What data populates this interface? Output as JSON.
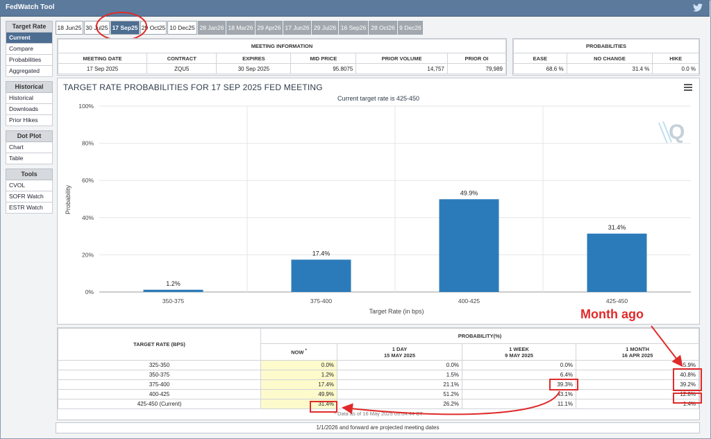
{
  "app": {
    "title": "FedWatch Tool"
  },
  "sidebar": {
    "groups": [
      {
        "heading": "Target Rate",
        "items": [
          "Current",
          "Compare",
          "Probabilities",
          "Aggregated"
        ]
      },
      {
        "heading": "Historical",
        "items": [
          "Historical",
          "Downloads",
          "Prior Hikes"
        ]
      },
      {
        "heading": "Dot Plot",
        "items": [
          "Chart",
          "Table"
        ]
      },
      {
        "heading": "Tools",
        "items": [
          "CVOL",
          "SOFR Watch",
          "ESTR Watch"
        ]
      }
    ],
    "active": "Current"
  },
  "tabs": [
    "18 Jun25",
    "30 Jul25",
    "17 Sep25",
    "29 Oct25",
    "10 Dec25",
    "28 Jan26",
    "18 Mar26",
    "29 Apr26",
    "17 Jun26",
    "29 Jul26",
    "16 Sep26",
    "28 Oct26",
    "9 Dec26"
  ],
  "meeting_info": {
    "heading": "MEETING INFORMATION",
    "columns": [
      "MEETING DATE",
      "CONTRACT",
      "EXPIRES",
      "MID PRICE",
      "PRIOR VOLUME",
      "PRIOR OI"
    ],
    "values": [
      "17 Sep 2025",
      "ZQU5",
      "30 Sep 2025",
      "95.8075",
      "14,757",
      "79,989"
    ]
  },
  "probabilities": {
    "heading": "PROBABILITIES",
    "columns": [
      "EASE",
      "NO CHANGE",
      "HIKE"
    ],
    "values": [
      "68.6 %",
      "31.4 %",
      "0.0 %"
    ]
  },
  "chart_data": {
    "type": "bar",
    "title": "TARGET RATE PROBABILITIES FOR 17 SEP 2025 FED MEETING",
    "subtitle": "Current target rate is 425-450",
    "xlabel": "Target Rate (in bps)",
    "ylabel": "Probability",
    "categories": [
      "350-375",
      "375-400",
      "400-425",
      "425-450"
    ],
    "values": [
      1.2,
      17.4,
      49.9,
      31.4
    ],
    "value_labels": [
      "1.2%",
      "17.4%",
      "49.9%",
      "31.4%"
    ],
    "ylim": [
      0,
      100
    ],
    "yticks": [
      "0%",
      "20%",
      "40%",
      "60%",
      "80%",
      "100%"
    ],
    "bar_color": "#2b7bba"
  },
  "prob_table": {
    "target_header": "TARGET RATE (BPS)",
    "prob_header": "PROBABILITY(%)",
    "col_now": "NOW",
    "col_now_mark": "*",
    "col_1day": "1 DAY",
    "col_1day_date": "15 MAY 2025",
    "col_1week": "1 WEEK",
    "col_1week_date": "9 MAY 2025",
    "col_1month": "1 MONTH",
    "col_1month_date": "16 APR 2025",
    "rows": [
      {
        "rate": "325-350",
        "now": "0.0%",
        "day": "0.0%",
        "week": "0.0%",
        "month": "5.9%"
      },
      {
        "rate": "350-375",
        "now": "1.2%",
        "day": "1.5%",
        "week": "6.4%",
        "month": "40.8%"
      },
      {
        "rate": "375-400",
        "now": "17.4%",
        "day": "21.1%",
        "week": "39.3%",
        "month": "39.2%"
      },
      {
        "rate": "400-425",
        "now": "49.9%",
        "day": "51.2%",
        "week": "43.1%",
        "month": "12.8%"
      },
      {
        "rate": "425-450 (Current)",
        "now": "31.4%",
        "day": "26.2%",
        "week": "11.1%",
        "month": "1.4%"
      }
    ],
    "data_note": "* Data as of 16 May 2025 05:04:44 CT"
  },
  "footer": "1/1/2026 and forward are projected meeting dates",
  "annotation": {
    "month_ago": "Month ago",
    "color": "#e02a2a"
  }
}
